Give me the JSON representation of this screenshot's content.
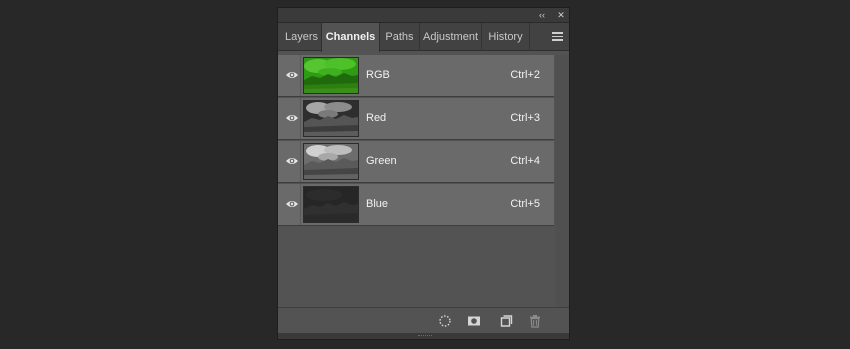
{
  "window": {
    "collapse_icon": "double-chevron-left-icon",
    "close_icon": "close-icon",
    "collapse_glyph": "‹‹",
    "close_glyph": "✕"
  },
  "tabs": [
    {
      "label": "Layers",
      "active": false
    },
    {
      "label": "Channels",
      "active": true
    },
    {
      "label": "Paths",
      "active": false
    },
    {
      "label": "Adjustment",
      "active": false
    },
    {
      "label": "History",
      "active": false
    }
  ],
  "panel_menu_icon": "hamburger-menu-icon",
  "channels": [
    {
      "name": "RGB",
      "shortcut": "Ctrl+2",
      "visible": true,
      "thumb": "rgb"
    },
    {
      "name": "Red",
      "shortcut": "Ctrl+3",
      "visible": true,
      "thumb": "red"
    },
    {
      "name": "Green",
      "shortcut": "Ctrl+4",
      "visible": true,
      "thumb": "green"
    },
    {
      "name": "Blue",
      "shortcut": "Ctrl+5",
      "visible": true,
      "thumb": "blue"
    }
  ],
  "bottom_buttons": [
    {
      "name": "load-channel-as-selection-icon"
    },
    {
      "name": "save-selection-as-channel-icon"
    },
    {
      "name": "create-new-channel-icon"
    },
    {
      "name": "delete-channel-icon"
    }
  ],
  "colors": {
    "background": "#282828",
    "panel": "#535353",
    "row": "#6a6a6a",
    "tabbar": "#424242",
    "rgb_thumb": "#33a31a"
  }
}
